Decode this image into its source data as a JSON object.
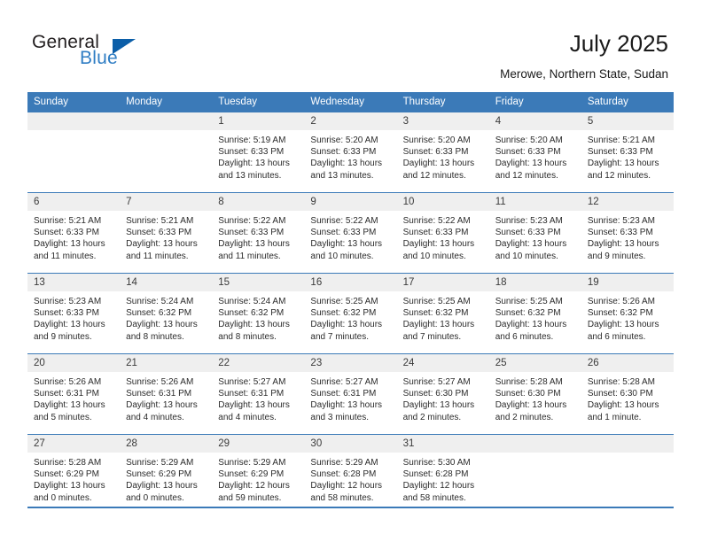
{
  "brand": {
    "name_top": "General",
    "name_bottom": "Blue",
    "triangle_color": "#0b5ea8",
    "blue_color": "#2f7dc4"
  },
  "header": {
    "title": "July 2025",
    "subtitle": "Merowe, Northern State, Sudan"
  },
  "theme": {
    "header_bg": "#3b7ab8",
    "header_text": "#ffffff",
    "daynum_bg": "#efefef",
    "row_divider": "#3b7ab8"
  },
  "weekday_headers": [
    "Sunday",
    "Monday",
    "Tuesday",
    "Wednesday",
    "Thursday",
    "Friday",
    "Saturday"
  ],
  "weeks": [
    [
      {
        "day": "",
        "lines": []
      },
      {
        "day": "",
        "lines": []
      },
      {
        "day": "1",
        "lines": [
          "Sunrise: 5:19 AM",
          "Sunset: 6:33 PM",
          "Daylight: 13 hours",
          "and 13 minutes."
        ]
      },
      {
        "day": "2",
        "lines": [
          "Sunrise: 5:20 AM",
          "Sunset: 6:33 PM",
          "Daylight: 13 hours",
          "and 13 minutes."
        ]
      },
      {
        "day": "3",
        "lines": [
          "Sunrise: 5:20 AM",
          "Sunset: 6:33 PM",
          "Daylight: 13 hours",
          "and 12 minutes."
        ]
      },
      {
        "day": "4",
        "lines": [
          "Sunrise: 5:20 AM",
          "Sunset: 6:33 PM",
          "Daylight: 13 hours",
          "and 12 minutes."
        ]
      },
      {
        "day": "5",
        "lines": [
          "Sunrise: 5:21 AM",
          "Sunset: 6:33 PM",
          "Daylight: 13 hours",
          "and 12 minutes."
        ]
      }
    ],
    [
      {
        "day": "6",
        "lines": [
          "Sunrise: 5:21 AM",
          "Sunset: 6:33 PM",
          "Daylight: 13 hours",
          "and 11 minutes."
        ]
      },
      {
        "day": "7",
        "lines": [
          "Sunrise: 5:21 AM",
          "Sunset: 6:33 PM",
          "Daylight: 13 hours",
          "and 11 minutes."
        ]
      },
      {
        "day": "8",
        "lines": [
          "Sunrise: 5:22 AM",
          "Sunset: 6:33 PM",
          "Daylight: 13 hours",
          "and 11 minutes."
        ]
      },
      {
        "day": "9",
        "lines": [
          "Sunrise: 5:22 AM",
          "Sunset: 6:33 PM",
          "Daylight: 13 hours",
          "and 10 minutes."
        ]
      },
      {
        "day": "10",
        "lines": [
          "Sunrise: 5:22 AM",
          "Sunset: 6:33 PM",
          "Daylight: 13 hours",
          "and 10 minutes."
        ]
      },
      {
        "day": "11",
        "lines": [
          "Sunrise: 5:23 AM",
          "Sunset: 6:33 PM",
          "Daylight: 13 hours",
          "and 10 minutes."
        ]
      },
      {
        "day": "12",
        "lines": [
          "Sunrise: 5:23 AM",
          "Sunset: 6:33 PM",
          "Daylight: 13 hours",
          "and 9 minutes."
        ]
      }
    ],
    [
      {
        "day": "13",
        "lines": [
          "Sunrise: 5:23 AM",
          "Sunset: 6:33 PM",
          "Daylight: 13 hours",
          "and 9 minutes."
        ]
      },
      {
        "day": "14",
        "lines": [
          "Sunrise: 5:24 AM",
          "Sunset: 6:32 PM",
          "Daylight: 13 hours",
          "and 8 minutes."
        ]
      },
      {
        "day": "15",
        "lines": [
          "Sunrise: 5:24 AM",
          "Sunset: 6:32 PM",
          "Daylight: 13 hours",
          "and 8 minutes."
        ]
      },
      {
        "day": "16",
        "lines": [
          "Sunrise: 5:25 AM",
          "Sunset: 6:32 PM",
          "Daylight: 13 hours",
          "and 7 minutes."
        ]
      },
      {
        "day": "17",
        "lines": [
          "Sunrise: 5:25 AM",
          "Sunset: 6:32 PM",
          "Daylight: 13 hours",
          "and 7 minutes."
        ]
      },
      {
        "day": "18",
        "lines": [
          "Sunrise: 5:25 AM",
          "Sunset: 6:32 PM",
          "Daylight: 13 hours",
          "and 6 minutes."
        ]
      },
      {
        "day": "19",
        "lines": [
          "Sunrise: 5:26 AM",
          "Sunset: 6:32 PM",
          "Daylight: 13 hours",
          "and 6 minutes."
        ]
      }
    ],
    [
      {
        "day": "20",
        "lines": [
          "Sunrise: 5:26 AM",
          "Sunset: 6:31 PM",
          "Daylight: 13 hours",
          "and 5 minutes."
        ]
      },
      {
        "day": "21",
        "lines": [
          "Sunrise: 5:26 AM",
          "Sunset: 6:31 PM",
          "Daylight: 13 hours",
          "and 4 minutes."
        ]
      },
      {
        "day": "22",
        "lines": [
          "Sunrise: 5:27 AM",
          "Sunset: 6:31 PM",
          "Daylight: 13 hours",
          "and 4 minutes."
        ]
      },
      {
        "day": "23",
        "lines": [
          "Sunrise: 5:27 AM",
          "Sunset: 6:31 PM",
          "Daylight: 13 hours",
          "and 3 minutes."
        ]
      },
      {
        "day": "24",
        "lines": [
          "Sunrise: 5:27 AM",
          "Sunset: 6:30 PM",
          "Daylight: 13 hours",
          "and 2 minutes."
        ]
      },
      {
        "day": "25",
        "lines": [
          "Sunrise: 5:28 AM",
          "Sunset: 6:30 PM",
          "Daylight: 13 hours",
          "and 2 minutes."
        ]
      },
      {
        "day": "26",
        "lines": [
          "Sunrise: 5:28 AM",
          "Sunset: 6:30 PM",
          "Daylight: 13 hours",
          "and 1 minute."
        ]
      }
    ],
    [
      {
        "day": "27",
        "lines": [
          "Sunrise: 5:28 AM",
          "Sunset: 6:29 PM",
          "Daylight: 13 hours",
          "and 0 minutes."
        ]
      },
      {
        "day": "28",
        "lines": [
          "Sunrise: 5:29 AM",
          "Sunset: 6:29 PM",
          "Daylight: 13 hours",
          "and 0 minutes."
        ]
      },
      {
        "day": "29",
        "lines": [
          "Sunrise: 5:29 AM",
          "Sunset: 6:29 PM",
          "Daylight: 12 hours",
          "and 59 minutes."
        ]
      },
      {
        "day": "30",
        "lines": [
          "Sunrise: 5:29 AM",
          "Sunset: 6:28 PM",
          "Daylight: 12 hours",
          "and 58 minutes."
        ]
      },
      {
        "day": "31",
        "lines": [
          "Sunrise: 5:30 AM",
          "Sunset: 6:28 PM",
          "Daylight: 12 hours",
          "and 58 minutes."
        ]
      },
      {
        "day": "",
        "lines": []
      },
      {
        "day": "",
        "lines": []
      }
    ]
  ]
}
